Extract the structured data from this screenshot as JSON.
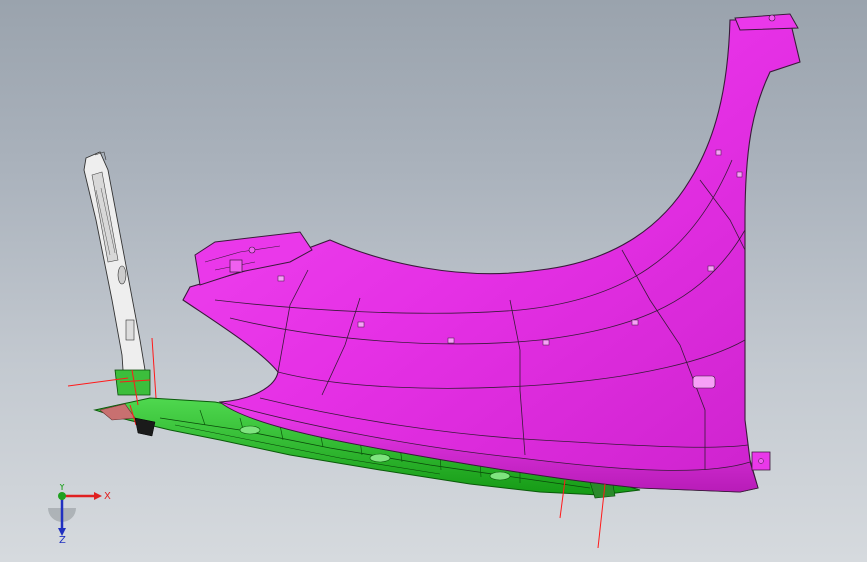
{
  "app": {
    "view_type": "3D CAD model viewport",
    "background_top": "#9aa3ad",
    "background_bottom": "#d6dade"
  },
  "model": {
    "fender_color": "#ee33ee",
    "fender_edge_color": "#3a1a3a",
    "bracket_color": "#e8e8e8",
    "underbody_color": "#22bb22",
    "reference_line_color": "#ff1a1a"
  },
  "triad": {
    "x_label": "X",
    "y_label": "Y",
    "z_label": "Z",
    "x_color": "#e02020",
    "y_color": "#20a020",
    "z_color": "#2030c0"
  }
}
